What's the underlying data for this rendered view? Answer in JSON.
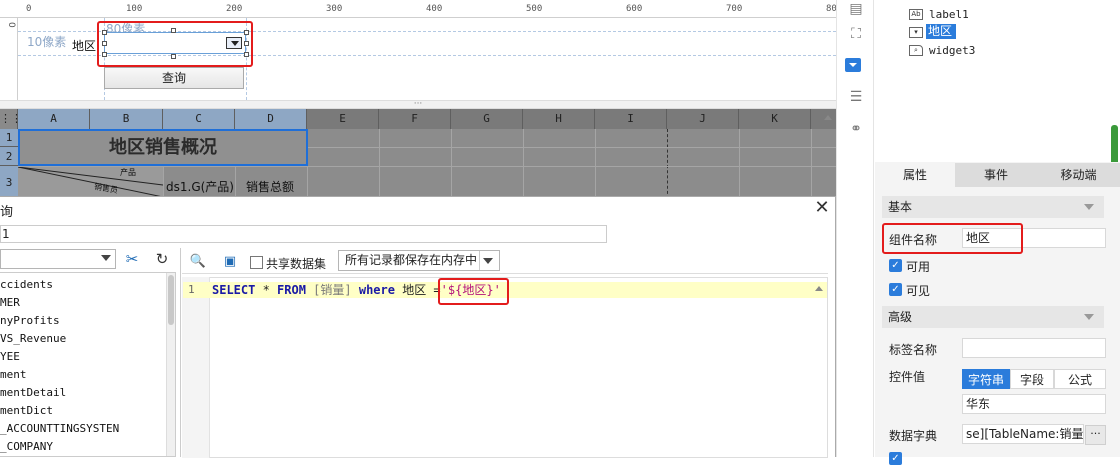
{
  "ruler": {
    "h_numbers": [
      "0",
      "100",
      "200",
      "300",
      "400",
      "500",
      "600",
      "700",
      "80"
    ],
    "v_numbers": [
      "0"
    ]
  },
  "canvas": {
    "measure_left": "10像素",
    "measure_top": "80像素",
    "region_label": "地区",
    "query_button": "查询"
  },
  "sheet": {
    "columns": [
      "A",
      "B",
      "C",
      "D",
      "E",
      "F",
      "G",
      "H",
      "I",
      "J",
      "K"
    ],
    "rows": [
      "1",
      "2",
      "3"
    ],
    "title": "地区销售概况",
    "slash_top": "产品",
    "slash_bottom": "销售员",
    "c3": "ds1.G(产品)",
    "d3": "销售总额"
  },
  "dialog": {
    "title_fragment": "询",
    "name_value": "1",
    "close": "✕",
    "share_dataset": "共享数据集",
    "memory_option": "所有记录都保存在内存中",
    "tables": [
      "ccidents",
      "MER",
      "nyProfits",
      "VS_Revenue",
      "YEE",
      "ment",
      "mentDetail",
      "mentDict",
      "_ACCOUNTTINGSYSTEN",
      "_COMPANY"
    ],
    "sql": {
      "line_number": "1",
      "kw_select": "SELECT",
      "star": " * ",
      "kw_from": "FROM",
      "table": " [销量] ",
      "kw_where": "where",
      "condition": " 地区 =",
      "param": "'${地区}'"
    }
  },
  "tree": {
    "items": [
      "label1",
      "地区",
      "widget3"
    ]
  },
  "props": {
    "tabs": [
      "属性",
      "事件",
      "移动端"
    ],
    "section_basic": "基本",
    "component_name_label": "组件名称",
    "component_name_value": "地区",
    "enabled_label": "可用",
    "visible_label": "可见",
    "section_advanced": "高级",
    "tag_name_label": "标签名称",
    "tag_name_value": "",
    "control_value_label": "控件值",
    "value_types": [
      "字符串",
      "字段",
      "公式"
    ],
    "control_value": "华东",
    "dict_label": "数据字典",
    "dict_value": "se][TableName:销量]",
    "dict_more": "···"
  },
  "colors": {
    "accent": "#2b7cdb",
    "highlight_red": "#e31c1c",
    "sql_keyword": "#1a1aa6",
    "sql_param": "#b3127b"
  }
}
